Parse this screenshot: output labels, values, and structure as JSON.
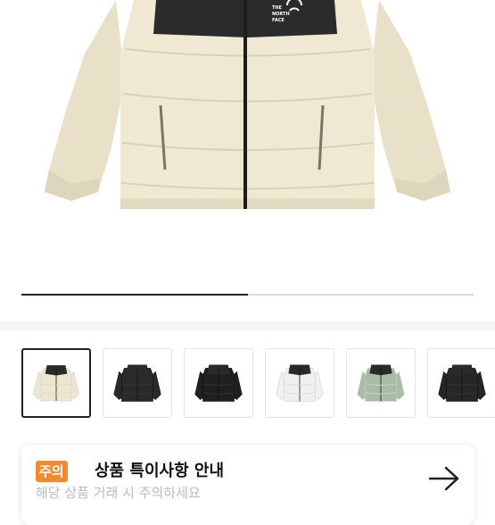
{
  "hero": {
    "image_icon": "puffer-jacket-image",
    "logo_text": "THE NORTH FACE",
    "gallery_progress": 0.5
  },
  "thumbnails": [
    {
      "name": "cream-jacket",
      "color": "#ece6cf",
      "active": true
    },
    {
      "name": "black-jacket",
      "color": "#2a2a2a",
      "active": false
    },
    {
      "name": "black-shiny-jacket",
      "color": "#1f1f1f",
      "active": false
    },
    {
      "name": "white-jacket",
      "color": "#f0f0f0",
      "active": false
    },
    {
      "name": "sage-jacket",
      "color": "#a9bca6",
      "active": false
    },
    {
      "name": "black-jacket-2",
      "color": "#262626",
      "active": false
    }
  ],
  "notice": {
    "badge": "주의",
    "title": "상품 특이사항 안내",
    "subtitle": "해당 상품 거래 시 주의하세요",
    "arrow_icon": "arrow-right-icon"
  },
  "colors": {
    "accent": "#f08a2c",
    "dark": "#222222"
  }
}
